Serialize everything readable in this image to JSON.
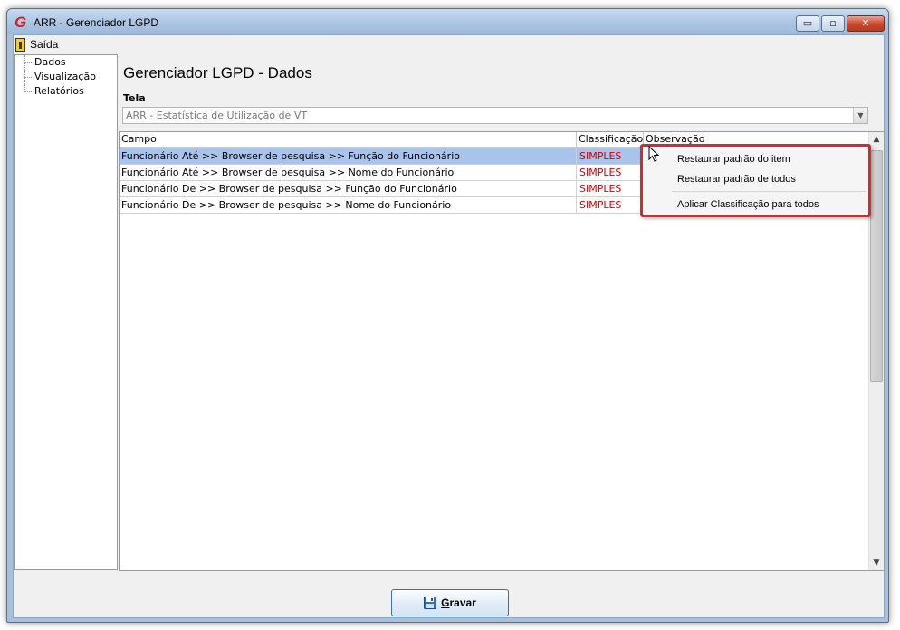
{
  "window": {
    "title": "ARR - Gerenciador LGPD",
    "app_icon_letter": "G",
    "controls": {
      "minimize": "▭",
      "maximize": "▫",
      "close": "✕"
    }
  },
  "menu": {
    "exit_label": "Saída"
  },
  "tree": {
    "items": [
      "Dados",
      "Visualização",
      "Relatórios"
    ]
  },
  "main": {
    "heading": "Gerenciador LGPD - Dados",
    "tela_label": "Tela",
    "tela_value": "ARR - Estatística de Utilização de VT",
    "combo_arrow": "▼"
  },
  "grid": {
    "columns": [
      "Campo",
      "Classificação",
      "Observação"
    ],
    "rows": [
      {
        "campo": "Funcionário Até >> Browser de pesquisa >> Função do Funcionário",
        "classificacao": "SIMPLES",
        "observacao": ""
      },
      {
        "campo": "Funcionário Até >> Browser de pesquisa >> Nome do Funcionário",
        "classificacao": "SIMPLES",
        "observacao": ""
      },
      {
        "campo": "Funcionário De >> Browser de pesquisa >> Função do Funcionário",
        "classificacao": "SIMPLES",
        "observacao": ""
      },
      {
        "campo": "Funcionário De >> Browser de pesquisa >> Nome do Funcionário",
        "classificacao": "SIMPLES",
        "observacao": ""
      }
    ],
    "selected_row": 0
  },
  "context_menu": {
    "items": [
      "Restaurar padrão do item",
      "Restaurar padrão de todos",
      "Aplicar Classificação para todos"
    ],
    "highlight_color": "#d42a2a"
  },
  "footer": {
    "save_label": "Gravar"
  },
  "colors": {
    "title_accent": "#d42020",
    "classification_text": "#d40000",
    "selection": "#a8c4ec"
  }
}
